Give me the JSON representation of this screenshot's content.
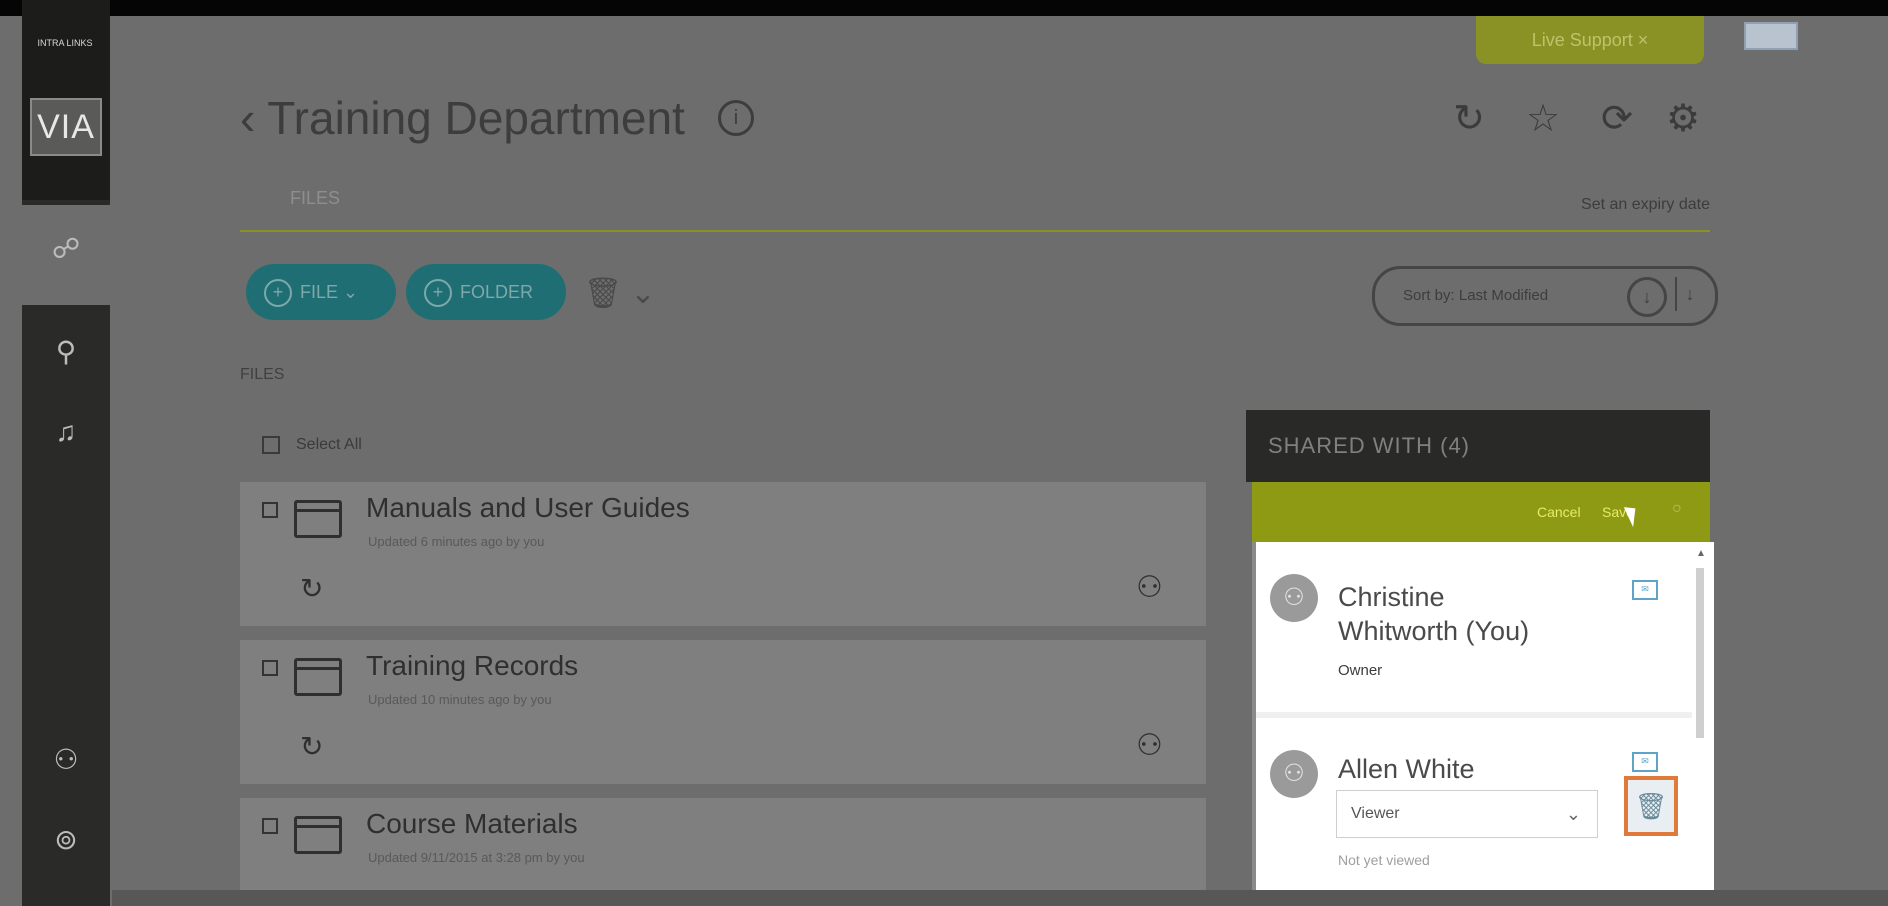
{
  "live_support": {
    "label": "Live Support",
    "close": "×"
  },
  "sidebar": {
    "logo_top": "INTRA LINKS",
    "logo_main": "VIA"
  },
  "header": {
    "title": "Training Department",
    "tab": "FILES",
    "expiry_link": "Set an expiry date"
  },
  "toolbar": {
    "file_button": "FILE",
    "folder_button": "FOLDER",
    "sort_label": "Sort by: Last Modified"
  },
  "files": {
    "section_label": "FILES",
    "select_all": "Select All",
    "items": [
      {
        "name": "Manuals and User Guides",
        "updated": "Updated 6 minutes ago by you"
      },
      {
        "name": "Training Records",
        "updated": "Updated 10 minutes ago by you"
      },
      {
        "name": "Course Materials",
        "updated": "Updated 9/11/2015 at 3:28 pm by you"
      }
    ]
  },
  "share_panel": {
    "header": "SHARED WITH (4)",
    "cancel": "Cancel",
    "save": "Save",
    "users": [
      {
        "name_line1": "Christine",
        "name_line2": "Whitworth (You)",
        "role": "Owner"
      },
      {
        "name": "Allen White",
        "role": "Viewer",
        "status": "Not yet viewed"
      }
    ]
  }
}
